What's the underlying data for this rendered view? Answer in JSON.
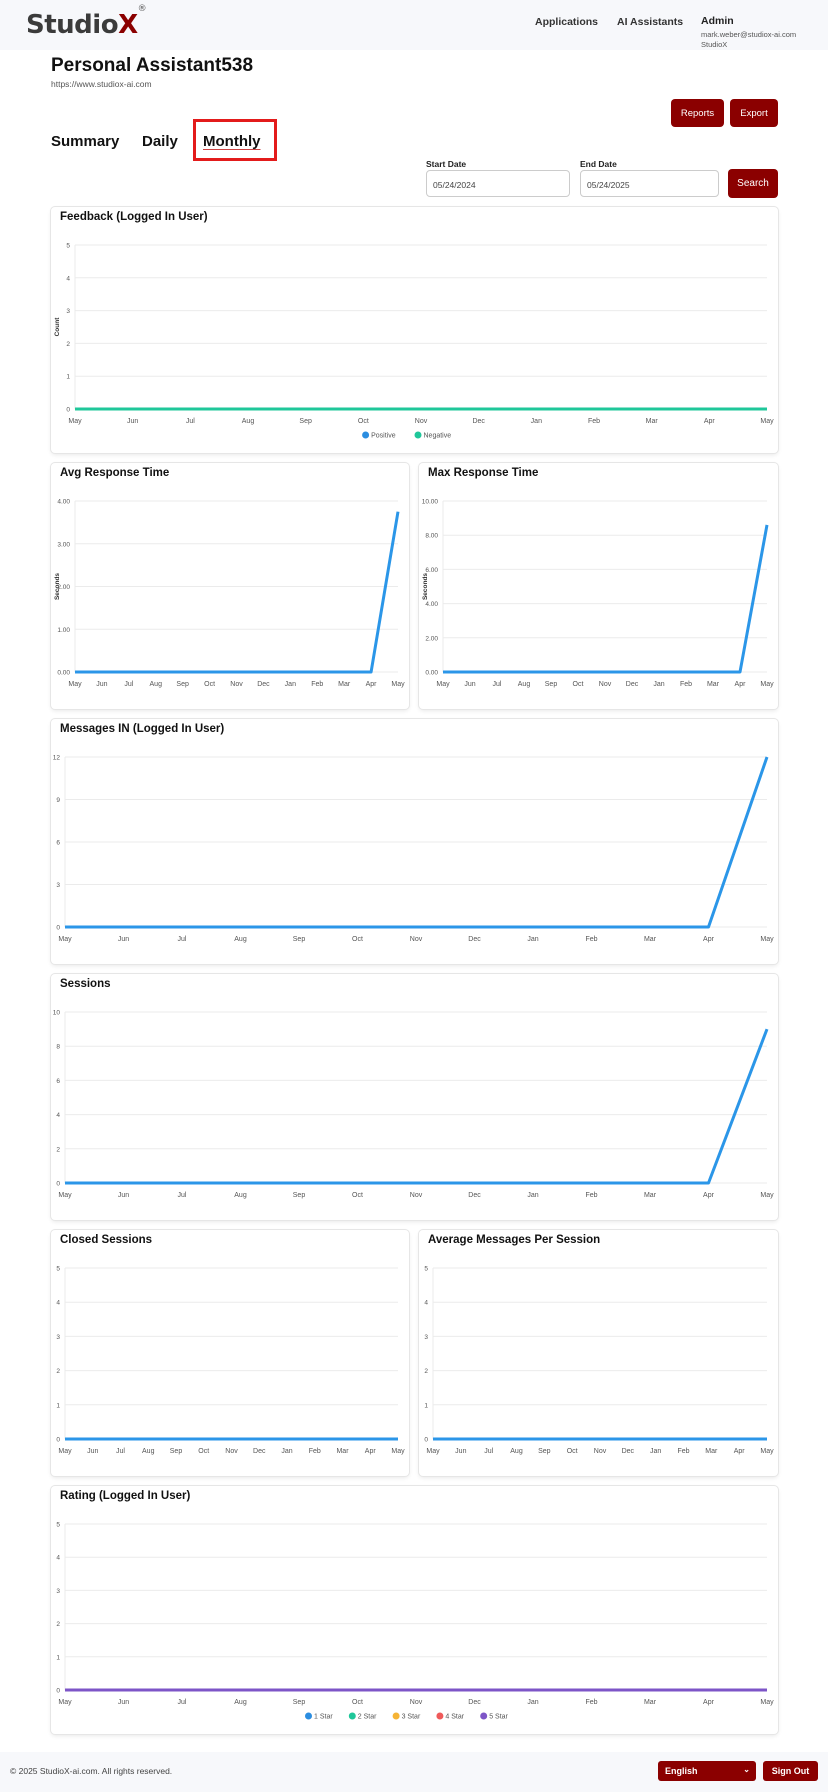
{
  "header": {
    "logo_text": "Studio",
    "logo_x": "X",
    "logo_reg": "®",
    "nav": [
      "Applications",
      "AI Assistants"
    ],
    "user_name": "Admin",
    "user_email": "mark.weber@studiox-ai.com",
    "user_org": "StudioX"
  },
  "page": {
    "title": "Personal Assistant538",
    "url": "https://www.studiox-ai.com",
    "reports_label": "Reports",
    "export_label": "Export"
  },
  "tabs": [
    "Summary",
    "Daily",
    "Monthly"
  ],
  "active_tab": "Monthly",
  "filters": {
    "start_label": "Start Date",
    "start_value": "05/24/2024",
    "end_label": "End Date",
    "end_value": "05/24/2025",
    "search_label": "Search"
  },
  "chart_data": [
    {
      "id": "feedback",
      "type": "line",
      "title": "Feedback (Logged In User)",
      "ylabel": "Count",
      "ylim": [
        0,
        5
      ],
      "yticks": [
        "0",
        "1",
        "2",
        "3",
        "4",
        "5"
      ],
      "x": [
        "May",
        "Jun",
        "Jul",
        "Aug",
        "Sep",
        "Oct",
        "Nov",
        "Dec",
        "Jan",
        "Feb",
        "Mar",
        "Apr",
        "May"
      ],
      "legend": "bottom",
      "grid": true,
      "series": [
        {
          "name": "Positive",
          "color": "#2b8de0",
          "values": [
            0,
            0,
            0,
            0,
            0,
            0,
            0,
            0,
            0,
            0,
            0,
            0,
            0
          ]
        },
        {
          "name": "Negative",
          "color": "#1fc79a",
          "values": [
            0,
            0,
            0,
            0,
            0,
            0,
            0,
            0,
            0,
            0,
            0,
            0,
            0
          ]
        }
      ]
    },
    {
      "id": "avg_response",
      "type": "line",
      "title": "Avg Response Time",
      "ylabel": "Seconds",
      "ylim": [
        0,
        4
      ],
      "yticks": [
        "0.00",
        "1.00",
        "2.00",
        "3.00",
        "4.00"
      ],
      "x": [
        "May",
        "Jun",
        "Jul",
        "Aug",
        "Sep",
        "Oct",
        "Nov",
        "Dec",
        "Jan",
        "Feb",
        "Mar",
        "Apr",
        "May"
      ],
      "grid": true,
      "series": [
        {
          "color": "#2b96e8",
          "values": [
            0,
            0,
            0,
            0,
            0,
            0,
            0,
            0,
            0,
            0,
            0,
            0,
            3.75
          ]
        }
      ]
    },
    {
      "id": "max_response",
      "type": "line",
      "title": "Max Response Time",
      "ylabel": "Seconds",
      "ylim": [
        0,
        10
      ],
      "yticks": [
        "0.00",
        "2.00",
        "4.00",
        "6.00",
        "8.00",
        "10.00"
      ],
      "x": [
        "May",
        "Jun",
        "Jul",
        "Aug",
        "Sep",
        "Oct",
        "Nov",
        "Dec",
        "Jan",
        "Feb",
        "Mar",
        "Apr",
        "May"
      ],
      "grid": true,
      "series": [
        {
          "color": "#2b96e8",
          "values": [
            0,
            0,
            0,
            0,
            0,
            0,
            0,
            0,
            0,
            0,
            0,
            0,
            8.6
          ]
        }
      ]
    },
    {
      "id": "messages_in",
      "type": "line",
      "title": "Messages IN (Logged In User)",
      "ylim": [
        0,
        12
      ],
      "yticks": [
        "0",
        "3",
        "6",
        "9",
        "12"
      ],
      "x": [
        "May",
        "Jun",
        "Jul",
        "Aug",
        "Sep",
        "Oct",
        "Nov",
        "Dec",
        "Jan",
        "Feb",
        "Mar",
        "Apr",
        "May"
      ],
      "grid": true,
      "series": [
        {
          "color": "#2b96e8",
          "values": [
            0,
            0,
            0,
            0,
            0,
            0,
            0,
            0,
            0,
            0,
            0,
            0,
            12
          ]
        }
      ]
    },
    {
      "id": "sessions",
      "type": "line",
      "title": "Sessions",
      "ylim": [
        0,
        10
      ],
      "yticks": [
        "0",
        "2",
        "4",
        "6",
        "8",
        "10"
      ],
      "x": [
        "May",
        "Jun",
        "Jul",
        "Aug",
        "Sep",
        "Oct",
        "Nov",
        "Dec",
        "Jan",
        "Feb",
        "Mar",
        "Apr",
        "May"
      ],
      "grid": true,
      "series": [
        {
          "color": "#2b96e8",
          "values": [
            0,
            0,
            0,
            0,
            0,
            0,
            0,
            0,
            0,
            0,
            0,
            0,
            9
          ]
        }
      ]
    },
    {
      "id": "closed_sessions",
      "type": "line",
      "title": "Closed Sessions",
      "ylim": [
        0,
        5
      ],
      "yticks": [
        "0",
        "1",
        "2",
        "3",
        "4",
        "5"
      ],
      "x": [
        "May",
        "Jun",
        "Jul",
        "Aug",
        "Sep",
        "Oct",
        "Nov",
        "Dec",
        "Jan",
        "Feb",
        "Mar",
        "Apr",
        "May"
      ],
      "grid": true,
      "series": [
        {
          "color": "#2b96e8",
          "values": [
            0,
            0,
            0,
            0,
            0,
            0,
            0,
            0,
            0,
            0,
            0,
            0,
            0
          ]
        }
      ]
    },
    {
      "id": "avg_messages",
      "type": "line",
      "title": "Average Messages Per Session",
      "ylim": [
        0,
        5
      ],
      "yticks": [
        "0",
        "1",
        "2",
        "3",
        "4",
        "5"
      ],
      "x": [
        "May",
        "Jun",
        "Jul",
        "Aug",
        "Sep",
        "Oct",
        "Nov",
        "Dec",
        "Jan",
        "Feb",
        "Mar",
        "Apr",
        "May"
      ],
      "grid": true,
      "series": [
        {
          "color": "#2b96e8",
          "values": [
            0,
            0,
            0,
            0,
            0,
            0,
            0,
            0,
            0,
            0,
            0,
            0,
            0
          ]
        }
      ]
    },
    {
      "id": "rating",
      "type": "line",
      "title": "Rating (Logged In User)",
      "ylim": [
        0,
        5
      ],
      "yticks": [
        "0",
        "1",
        "2",
        "3",
        "4",
        "5"
      ],
      "x": [
        "May",
        "Jun",
        "Jul",
        "Aug",
        "Sep",
        "Oct",
        "Nov",
        "Dec",
        "Jan",
        "Feb",
        "Mar",
        "Apr",
        "May"
      ],
      "legend": "bottom",
      "grid": true,
      "series": [
        {
          "name": "1 Star",
          "color": "#2b8de0",
          "values": [
            0,
            0,
            0,
            0,
            0,
            0,
            0,
            0,
            0,
            0,
            0,
            0,
            0
          ]
        },
        {
          "name": "2 Star",
          "color": "#1fc79a",
          "values": [
            0,
            0,
            0,
            0,
            0,
            0,
            0,
            0,
            0,
            0,
            0,
            0,
            0
          ]
        },
        {
          "name": "3 Star",
          "color": "#f5b335",
          "values": [
            0,
            0,
            0,
            0,
            0,
            0,
            0,
            0,
            0,
            0,
            0,
            0,
            0
          ]
        },
        {
          "name": "4 Star",
          "color": "#ef5a5a",
          "values": [
            0,
            0,
            0,
            0,
            0,
            0,
            0,
            0,
            0,
            0,
            0,
            0,
            0
          ]
        },
        {
          "name": "5 Star",
          "color": "#7d55c7",
          "values": [
            0,
            0,
            0,
            0,
            0,
            0,
            0,
            0,
            0,
            0,
            0,
            0,
            0
          ]
        }
      ]
    }
  ],
  "footer": {
    "copyright": "© 2025 StudioX-ai.com.  All rights reserved.",
    "language": "English",
    "caret": "⌄",
    "signout_label": "Sign Out"
  },
  "colors": {
    "brand": "#8b0000",
    "highlight": "#e31b1b"
  }
}
